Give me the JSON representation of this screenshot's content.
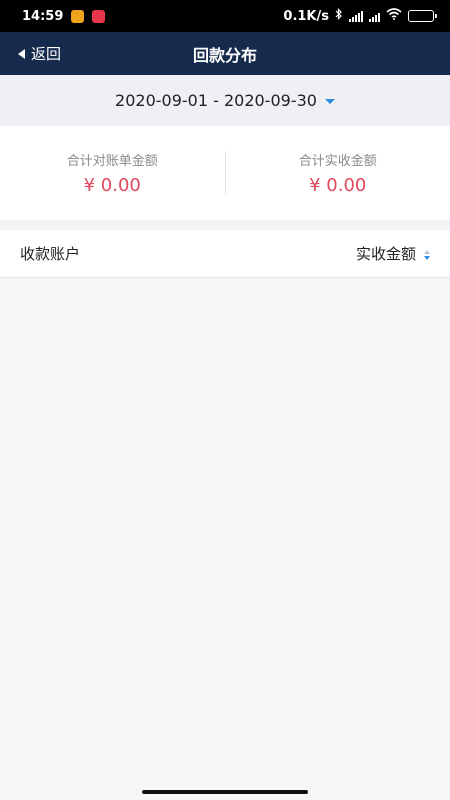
{
  "status_bar": {
    "time": "14:59",
    "network_speed": "0.1K/s",
    "icons": [
      "app-notification-orange",
      "app-notification-red",
      "bluetooth-icon",
      "signal-icon",
      "wifi-icon",
      "battery-icon"
    ]
  },
  "nav": {
    "back_label": "返回",
    "title": "回款分布"
  },
  "date_range": {
    "label": "2020-09-01 - 2020-09-30"
  },
  "summary": {
    "billed_label": "合计对账单金额",
    "billed_value": "¥ 0.00",
    "received_label": "合计实收金额",
    "received_value": "¥ 0.00"
  },
  "table": {
    "account_header": "收款账户",
    "amount_header": "实收金额",
    "rows": []
  },
  "colors": {
    "nav_bg": "#152a4c",
    "amount_red": "#e0495f",
    "accent_blue": "#2d8be0"
  }
}
